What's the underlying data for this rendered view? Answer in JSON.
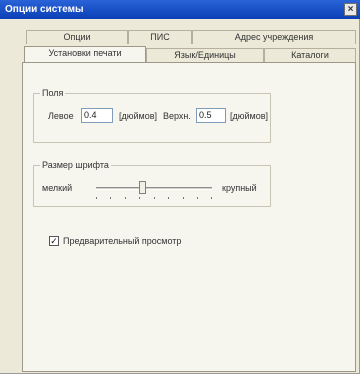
{
  "window": {
    "title": "Опции системы",
    "close_glyph": "×"
  },
  "tabs": {
    "row_back": [
      {
        "label": "Опции"
      },
      {
        "label": "ПИС"
      },
      {
        "label": "Адрес учреждения"
      }
    ],
    "row_front": [
      {
        "label": "Установки печати",
        "active": true
      },
      {
        "label": "Язык/Единицы"
      },
      {
        "label": "Каталоги"
      }
    ]
  },
  "margins": {
    "group_label": "Поля",
    "left_label": "Левое",
    "left_value": "0.4",
    "left_unit": "[дюймов]",
    "top_label": "Верхн.",
    "top_value": "0.5",
    "top_unit": "[дюймов]"
  },
  "font_size": {
    "group_label": "Размер шрифта",
    "small_label": "мелкий",
    "large_label": "крупный",
    "slider_level_fraction": 0.4
  },
  "preview": {
    "checked": true,
    "check_glyph": "✓",
    "label": "Предварительный просмотр"
  }
}
